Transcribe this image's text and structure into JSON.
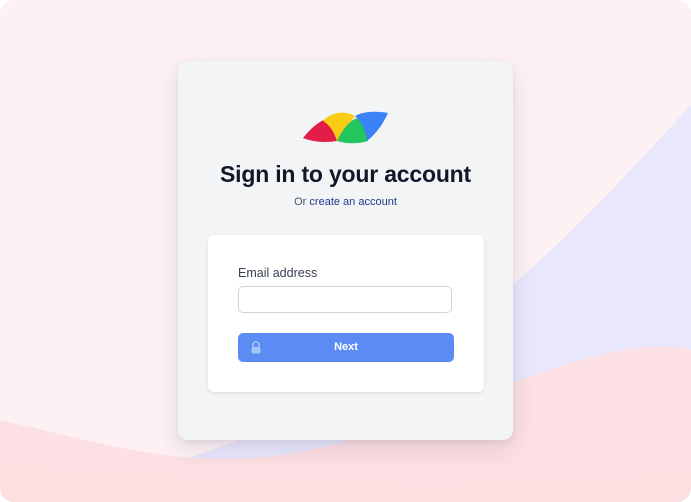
{
  "colors": {
    "page_background": "#fdf1f4",
    "card_background": "#f3f4f6",
    "primary_button": "#5b8bf3",
    "link": "#1e3a8a",
    "title_text": "#111827",
    "logo_red": "#e11d48",
    "logo_yellow": "#facc15",
    "logo_green": "#22c55e",
    "logo_blue": "#3b82f6"
  },
  "logo": {
    "icon": "brand-logo-icon"
  },
  "header": {
    "title": "Sign in to your account",
    "subtitle_prefix": "Or",
    "subtitle_link": "create an account"
  },
  "form": {
    "email_label": "Email address",
    "email_value": "",
    "email_placeholder": "",
    "next_button_label": "Next",
    "next_button_icon": "lock-icon"
  }
}
